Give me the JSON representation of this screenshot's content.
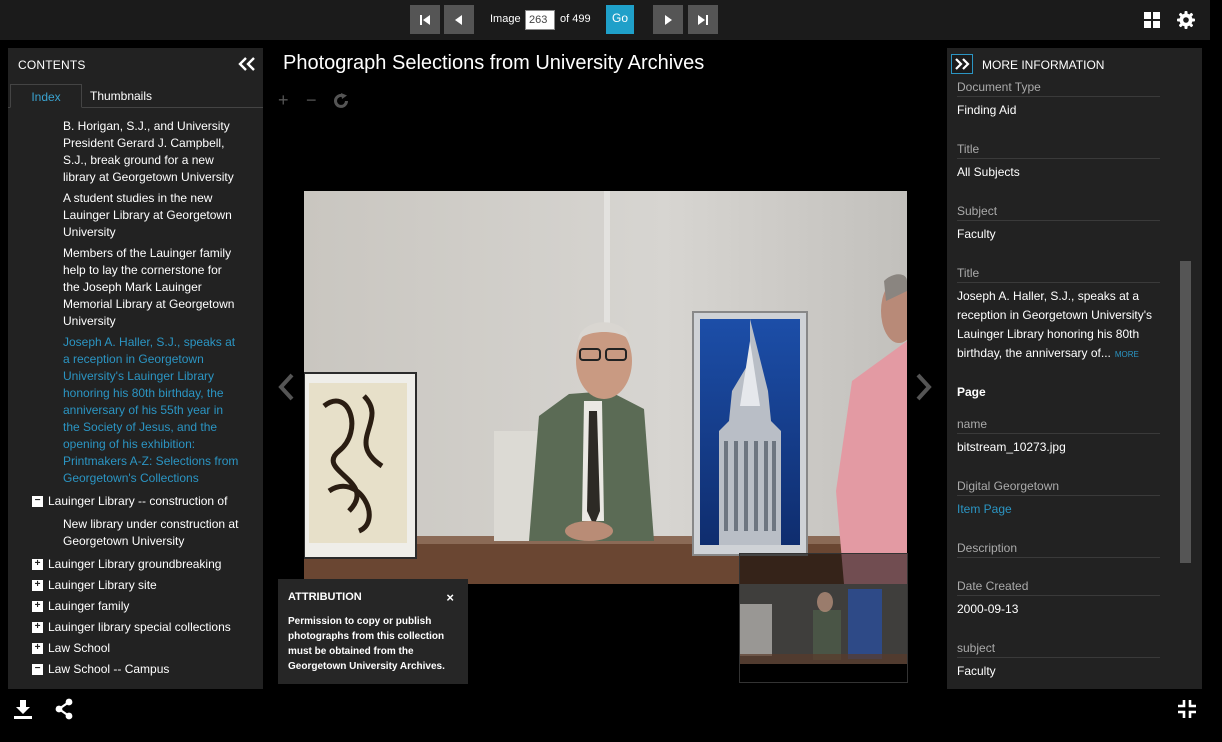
{
  "topbar": {
    "image_label": "Image",
    "image_value": "263",
    "of_label": "of 499",
    "go_label": "Go"
  },
  "contents": {
    "title": "CONTENTS",
    "tabs": [
      "Index",
      "Thumbnails"
    ],
    "leaf_1": [
      "B. Horigan, S.J., and University",
      "President Gerard J. Campbell,",
      "S.J., break ground for a new",
      "library at Georgetown University"
    ],
    "leaf_2": [
      "A student studies in the new",
      "Lauinger Library at Georgetown",
      "University"
    ],
    "leaf_3": [
      "Members of the Lauinger family",
      "help to lay the cornerstone for",
      "the Joseph Mark Lauinger",
      "Memorial Library at Georgetown",
      "University"
    ],
    "leaf_selected": [
      "Joseph A. Haller, S.J., speaks at",
      "a reception in Georgetown",
      "University's Lauinger Library",
      "honoring his 80th birthday, the",
      "anniversary of his 55th year in",
      "the Society of Jesus, and the",
      "opening of his exhibition:",
      "Printmakers A-Z: Selections from",
      "Georgetown's Collections"
    ],
    "node_expanded": "Lauinger Library -- construction of",
    "leaf_4": [
      "New library under construction at",
      "Georgetown University"
    ],
    "nodes": [
      "Lauinger Library groundbreaking",
      "Lauinger Library site",
      "Lauinger family",
      "Lauinger library special collections",
      "Law School",
      "Law School -- Campus"
    ]
  },
  "main": {
    "title": "Photograph Selections from University Archives"
  },
  "attribution": {
    "heading": "ATTRIBUTION",
    "close": "×",
    "text": "Permission to copy or publish photographs from this collection must be obtained from the Georgetown University Archives."
  },
  "info": {
    "title": "MORE INFORMATION",
    "fields": [
      {
        "label": "Document Type",
        "value": "Finding Aid"
      },
      {
        "label": "Title",
        "value": "All Subjects"
      },
      {
        "label": "Subject",
        "value": "Faculty"
      },
      {
        "label": "Title",
        "value": "Joseph A. Haller, S.J., speaks at a reception in Georgetown University's Lauinger Library honoring his 80th birthday, the anniversary of...",
        "more": "MORE"
      },
      {
        "label": "name",
        "value": "bitstream_10273.jpg"
      },
      {
        "label": "Digital Georgetown",
        "value": "Item Page"
      },
      {
        "label": "Description",
        "value": ""
      },
      {
        "label": "Date Created",
        "value": "2000-09-13"
      },
      {
        "label": "subject",
        "value": "Faculty"
      }
    ],
    "page_section": "Page"
  },
  "colors": {
    "accent": "#1fa0c9",
    "link": "#2b95c3",
    "panel": "#222222"
  }
}
